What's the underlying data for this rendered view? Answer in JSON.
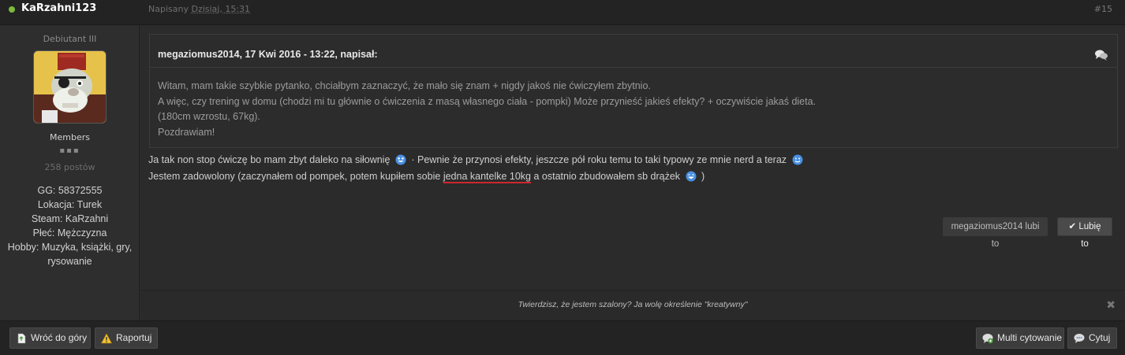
{
  "header": {
    "author": "KaRzahni123",
    "date_prefix": "Napisany",
    "date_value": "Dzisiaj, 15:31",
    "post_number": "#15"
  },
  "author_info": {
    "rank_title": "Debiutant III",
    "group": "Members",
    "rank_pips": "▪▪▪",
    "post_count": "258 postów",
    "fields": [
      "GG: 58372555",
      "Lokacja: Turek",
      "Steam: KaRzahni",
      "Płeć: Mężczyzna",
      "Hobby: Muzyka, książki, gry, rysowanie"
    ]
  },
  "quote": {
    "citation": "megaziomus2014, 17 Kwi 2016 - 13:22, napisał:",
    "lines": [
      "Witam, mam takie szybkie pytanko, chciałbym zaznaczyć, że mało się znam + nigdy jakoś nie ćwiczyłem zbytnio.",
      "A więc, czy trening w domu (chodzi mi tu głównie o ćwiczenia z masą własnego ciała - pompki) Może przynieść jakieś efekty? + oczywiście jakaś dieta.",
      "(180cm wzrostu, 67kg).",
      "Pozdrawiam!"
    ]
  },
  "content": {
    "line1_a": "Ja tak non stop ćwiczę bo mam zbyt daleko na siłownię",
    "line1_b": "· Pewnie że przynosi efekty, jeszcze pół roku temu to taki typowy ze mnie nerd a teraz",
    "line2_a": "Jestem zadowolony (zaczynałem od pompek, potem kupiłem sobie",
    "line2_underlined": "jedna kantelke 10kg",
    "line2_b": "a ostatnio zbudowałem sb drążek",
    "line2_c": ")"
  },
  "likes": {
    "info": "megaziomus2014 lubi to",
    "button": "✔ Lubię to"
  },
  "signature": {
    "text": "Twierdzisz, że jestem szalony? Ja wolę określenie \"kreatywny\"",
    "close": "✖"
  },
  "footer": {
    "back_to_top": "Wróć do góry",
    "report": "Raportuj",
    "multiquote": "Multi cytowanie",
    "quote": "Cytuj"
  },
  "colors": {
    "online": "#7cbb3a",
    "underline": "#d0262b",
    "smiley": "#4a90e2"
  }
}
